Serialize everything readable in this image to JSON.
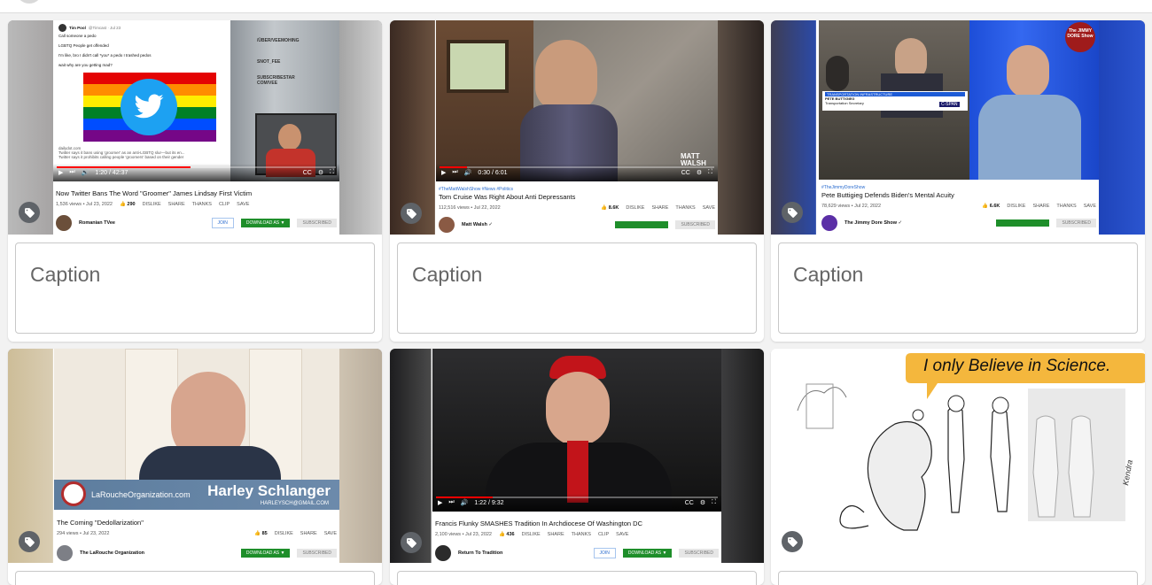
{
  "caption_placeholder": "Caption",
  "cards": [
    {
      "tag_icon": "tag-icon",
      "tweet": {
        "author": "Tim Pool",
        "handle": "@Timcast · Jul 23",
        "lines": [
          "Call someone a pedo",
          "LGBTQ People get offended",
          "I'm like, bro I didn't call *you* a pedo I trashed pedos",
          "wait why are you getting mad?"
        ],
        "source": "dailydot.com",
        "snippet": "Twitter says it bans using 'groomer' as an anti-LGBTQ slur—but its en...",
        "snippet2": "Twitter says it prohibits calling people 'groomers' based on their gender",
        "side_labels": [
          "/ÜBER/VEEMOHING",
          "SNOT_FEE",
          "SUBSCRIBESTAR COM/VEE"
        ]
      },
      "time": "1:20 / 42:37",
      "title": "Now Twitter Bans The Word \"Groomer\" James Lindsay First Victim",
      "views": "1,536 views • Jul 23, 2022",
      "likes": "290",
      "actions": [
        "DISLIKE",
        "SHARE",
        "THANKS",
        "CLIP",
        "SAVE"
      ],
      "channel": "Romanian TVee",
      "join": "JOIN",
      "download": "DOWNLOAD AS ▼",
      "subscribed": "SUBSCRIBED"
    },
    {
      "tag_icon": "tag-icon",
      "time": "0:30 / 6:01",
      "watermark": "MATT WALSH",
      "tags": "#TheMattWalshShow #News #Politics",
      "title": "Tom Cruise Was Right About Anti Depressants",
      "views": "112,516 views • Jul 22, 2022",
      "likes": "8.6K",
      "actions": [
        "DISLIKE",
        "SHARE",
        "THANKS",
        "SAVE"
      ],
      "channel": "Matt Walsh ✓",
      "download": "",
      "subscribed": "SUBSCRIBED"
    },
    {
      "tag_icon": "tag-icon",
      "logo": "The JIMMY DORE Show",
      "lower_third_top": "TRANSPORTATION INFRASTRUCTURE",
      "lower_third_name": "PETE BUTTIGIEG",
      "lower_third_role": "Transportation Secretary",
      "network": "C-SPAN",
      "tags": "#TheJimmyDoreShow",
      "title": "Pete Buttigieg Defends Biden's Mental Acuity",
      "views": "78,629 views • Jul 22, 2022",
      "likes": "6.6K",
      "actions": [
        "DISLIKE",
        "SHARE",
        "THANKS",
        "SAVE"
      ],
      "channel": "The Jimmy Dore Show ✓",
      "subscribed": "SUBSCRIBED"
    },
    {
      "tag_icon": "tag-icon",
      "org": "LaRoucheOrganization.com",
      "name": "Harley Schlanger",
      "email": "HARLEYSCH@GMAIL.COM",
      "title": "The Coming \"Dedollarization\"",
      "views": "294 views • Jul 23, 2022",
      "likes": "85",
      "actions": [
        "DISLIKE",
        "SHARE",
        "SAVE"
      ],
      "channel": "The LaRouche Organization",
      "download": "DOWNLOAD AS ▼",
      "subscribed": "SUBSCRIBED"
    },
    {
      "tag_icon": "tag-icon",
      "time": "1:22 / 9:32",
      "title": "Francis Flunky SMASHES Tradition In Archdiocese Of Washington DC",
      "views": "2,100 views • Jul 23, 2022",
      "likes": "436",
      "actions": [
        "DISLIKE",
        "SHARE",
        "THANKS",
        "CLIP",
        "SAVE"
      ],
      "channel": "Return To Tradition",
      "join": "JOIN",
      "download": "DOWNLOAD AS ▼",
      "subscribed": "SUBSCRIBED"
    },
    {
      "tag_icon": "tag-icon",
      "speech": "I only Believe in Science.",
      "signature": "Kendra"
    }
  ]
}
